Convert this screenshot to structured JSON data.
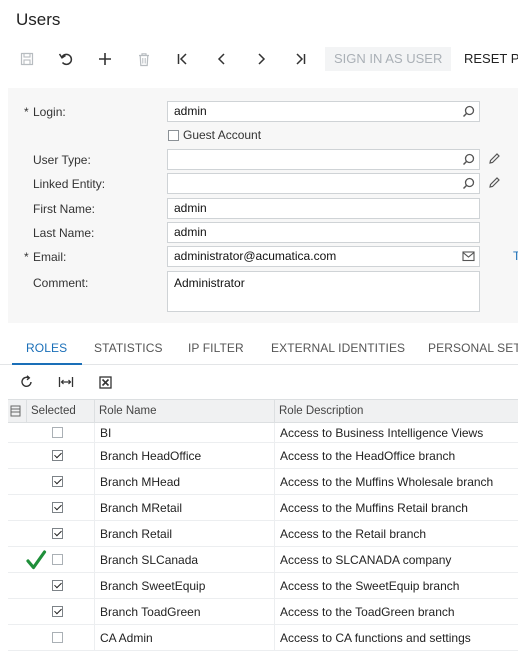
{
  "page": {
    "title": "Users"
  },
  "toolbar": {
    "icons": [
      "save-icon",
      "undo-icon",
      "add-icon",
      "delete-icon",
      "first-icon",
      "previous-icon",
      "next-icon",
      "last-icon"
    ],
    "sign_in_label": "SIGN IN AS USER",
    "reset_label": "RESET P"
  },
  "form": {
    "login": {
      "label": "Login:",
      "value": "admin"
    },
    "required_mark": "*",
    "guest_account": {
      "label": "Guest Account",
      "checked": false
    },
    "user_type": {
      "label": "User Type:",
      "value": ""
    },
    "linked_entity": {
      "label": "Linked Entity:",
      "value": ""
    },
    "first_name": {
      "label": "First Name:",
      "value": "admin"
    },
    "last_name": {
      "label": "Last Name:",
      "value": "admin"
    },
    "email": {
      "label": "Email:",
      "value": "administrator@acumatica.com"
    },
    "comment": {
      "label": "Comment:",
      "value": "Administrator"
    },
    "truncated_right": "T"
  },
  "tabs": [
    {
      "label": "ROLES",
      "active": true
    },
    {
      "label": "STATISTICS",
      "active": false
    },
    {
      "label": "IP FILTER",
      "active": false
    },
    {
      "label": "EXTERNAL IDENTITIES",
      "active": false
    },
    {
      "label": "PERSONAL SET",
      "active": false
    }
  ],
  "grid": {
    "toolbar_icons": [
      "refresh-icon",
      "fit-columns-icon",
      "export-excel-icon"
    ],
    "columns": [
      "Selected",
      "Role Name",
      "Role Description"
    ],
    "rows": [
      {
        "selected": false,
        "name": "BI",
        "description": "Access to Business Intelligence Views"
      },
      {
        "selected": true,
        "name": "Branch HeadOffice",
        "description": "Access to the HeadOffice branch"
      },
      {
        "selected": true,
        "name": "Branch MHead",
        "description": "Access to the Muffins Wholesale branch"
      },
      {
        "selected": true,
        "name": "Branch MRetail",
        "description": "Access to the Muffins Retail branch"
      },
      {
        "selected": true,
        "name": "Branch Retail",
        "description": "Access to the Retail branch"
      },
      {
        "selected": false,
        "name": "Branch SLCanada",
        "description": "Access to SLCANADA company",
        "marked": true
      },
      {
        "selected": true,
        "name": "Branch SweetEquip",
        "description": "Access to the SweetEquip branch"
      },
      {
        "selected": true,
        "name": "Branch ToadGreen",
        "description": "Access to the ToadGreen branch"
      },
      {
        "selected": false,
        "name": "CA Admin",
        "description": "Access to CA functions and settings"
      }
    ]
  },
  "colors": {
    "accent": "#1a6fb8",
    "checkmark_annotation": "#1f8f3a"
  }
}
